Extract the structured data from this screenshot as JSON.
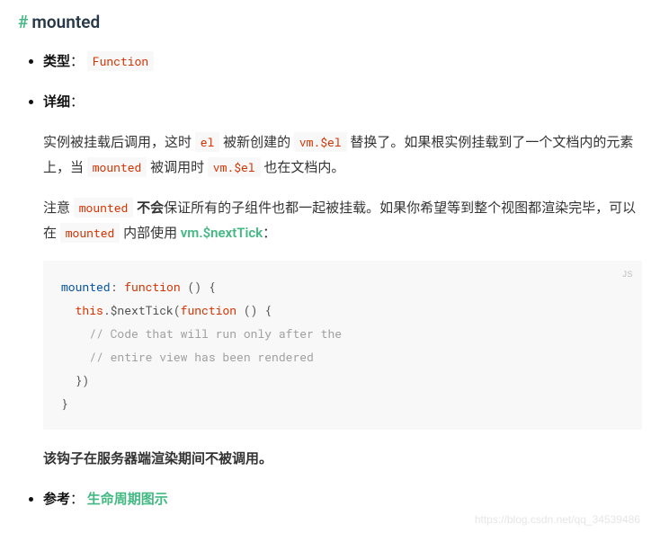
{
  "heading": {
    "hash": "#",
    "text": "mounted"
  },
  "items": {
    "type": {
      "label": "类型",
      "colon": "：",
      "value": "Function"
    },
    "detail": {
      "label": "详细",
      "colon": "："
    },
    "ref": {
      "label": "参考",
      "colon": "：",
      "link": "生命周期图示"
    }
  },
  "detail": {
    "p1": {
      "t1": "实例被挂载后调用，这时 ",
      "c1": "el",
      "t2": " 被新创建的 ",
      "c2": "vm.$el",
      "t3": " 替换了。如果根实例挂载到了一个文档内的元素上，当 ",
      "c3": "mounted",
      "t4": " 被调用时 ",
      "c4": "vm.$el",
      "t5": " 也在文档内。"
    },
    "p2": {
      "t1": "注意 ",
      "c1": "mounted",
      "t2": " ",
      "b1": "不会",
      "t3": "保证所有的子组件也都一起被挂载。如果你希望等到整个视图都渲染完毕，可以在 ",
      "c2": "mounted",
      "t4": " 内部使用 ",
      "link": "vm.$nextTick",
      "t5": "："
    },
    "code": {
      "lang": "JS",
      "l1a": "mounted",
      "l1b": ": ",
      "l1c": "function",
      "l1d": " () {",
      "l2a": "  ",
      "l2b": "this",
      "l2c": ".$nextTick(",
      "l2d": "function",
      "l2e": " () {",
      "l3": "    // Code that will run only after the",
      "l4": "    // entire view has been rendered",
      "l5": "  })",
      "l6": "}"
    },
    "note": "该钩子在服务器端渲染期间不被调用。"
  },
  "watermark": "https://blog.csdn.net/qq_34539486"
}
